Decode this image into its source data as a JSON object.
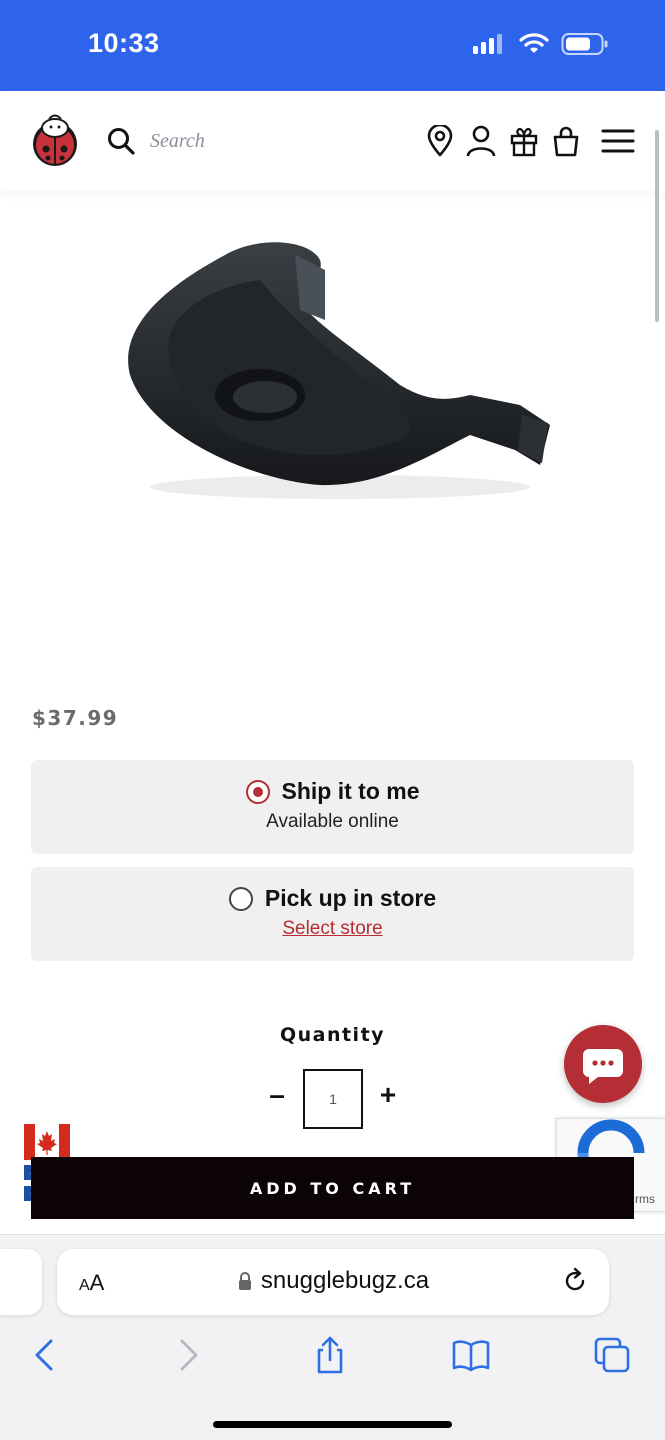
{
  "status_bar": {
    "time": "10:33",
    "icons": [
      "cellular-signal-icon",
      "wifi-icon",
      "battery-icon"
    ]
  },
  "header": {
    "logo": "snugglebugz-ladybug-logo",
    "search_placeholder": "Search",
    "icons": [
      "store-location-icon",
      "account-icon",
      "gift-registry-icon",
      "shopping-bag-icon",
      "menu-icon"
    ]
  },
  "product": {
    "image": "black-stroller-snack-tray",
    "price": "$37.99"
  },
  "delivery_options": [
    {
      "title": "Ship it to me",
      "subtitle": "Available online",
      "selected": true
    },
    {
      "title": "Pick up in store",
      "link": "Select store",
      "selected": false
    }
  ],
  "quantity": {
    "label": "Quantity",
    "value": "1",
    "minus": "–",
    "plus": "+"
  },
  "add_to_cart_label": "ADD TO CART",
  "recaptcha_fragment": "rms",
  "flags": [
    "canada-flag",
    "quebec-flag"
  ],
  "browser": {
    "aa_label_small": "A",
    "aa_label_large": "A",
    "url": "snugglebugz.ca",
    "toolbar": [
      "back-icon",
      "forward-icon",
      "share-icon",
      "bookmarks-icon",
      "tabs-icon"
    ]
  },
  "colors": {
    "status_bar": "#2e63ec",
    "brand_red": "#b52e35",
    "cart_button": "#0b0304",
    "option_bg": "#f0f0f0",
    "safari_blue": "#2f6fe4"
  }
}
